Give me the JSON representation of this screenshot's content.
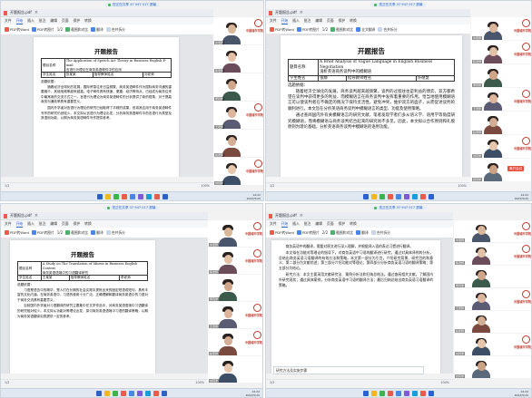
{
  "meeting_pill": "您正在共享 37 947 017 屏幕",
  "taskbar_time": "14:22",
  "taskbar_date": "2022/5/20",
  "leave_label": "离开会议",
  "panels": [
    {
      "file": "开题报告.pdf",
      "menus": [
        "文件",
        "开始",
        "插入",
        "批注",
        "编辑",
        "页面",
        "保护",
        "转换"
      ],
      "tools": [
        "PDF转Word",
        "PDF转图片",
        "截图和对比",
        "翻译",
        "合并拆分"
      ],
      "page_info": "1/2",
      "status": "1/2",
      "zoom": "100%",
      "doc_title": "开题报告",
      "table_rows": [
        [
          "题目名称",
          "The Application of Speech Act Theory in Business English E-mail\n言语行为理论在商务英语邮件中的应用"
        ],
        [
          "学生姓名",
          "张某某",
          "指导教师姓名",
          "刘老师"
        ]
      ],
      "section": "选题依据：",
      "paragraphs": [
        "随着经济全球化的发展，国际贸易往来日益频繁，商务英语邮件作为国际商务沟通的重要媒介，其使用频率越来越高。电子邮件具有快速、便捷、经济等特点，已经成为商务往来中最常用的交流方式之一。言语行为理论为商务英语邮件的分析提供了新的视角，对于提高商务沟通效率具有重要意义。",
        "国内外学者对言语行为理论的研究已经取得了丰硕的成果，但将其应用于商务英语邮件写作的研究仍然较少。本文拟从言语行为理论出发，分析商务英语邮件中的言语行为类型及其语用功能，以期为商务英语邮件写作提供参考。"
      ]
    },
    {
      "file": "开题报告.pdf",
      "menus": [
        "文件",
        "开始",
        "插入",
        "批注",
        "编辑",
        "页面",
        "保护",
        "转换"
      ],
      "tools": [
        "PDF转Word",
        "PDF转图片",
        "截图和对比",
        "全文翻译",
        "合并拆分"
      ],
      "page_info": "1/2",
      "status": "1/2",
      "zoom": "100%",
      "doc_title": "开题报告",
      "table_rows": [
        [
          "题目名称",
          "A Brief Analysis of Vague Language in English Business Negotiation\n浅析英语商务谈判中的模糊语"
        ],
        [
          "学生姓名",
          "张静",
          "指导教师姓名",
          "许德慧"
        ]
      ],
      "section": "选题依据：",
      "paragraphs": [
        "随着经济全球化的发展，商务谈判越来越频繁。谈判的过程往往是利益的博弈，双方都希望在谈判中获得更多的利益，而模糊语言在商务谈判中发挥着重要的作用。恰当地使用模糊语言可以使谈判者在不确定的情况下保持灵活性，避免冲突，维护双方的面子，从而促进谈判的顺利进行。本文旨在分析英语商务谈判中模糊语言的类型、功能及使用策略。",
        "通过查阅国内外有关模糊语言的研究文献，笔者发现学者们多从语义学、语用学等角度研究模糊语，而将模糊语与商务谈判结合起来的研究尚不多见。因此，本文拟以合作原则和礼貌原则为理论基础，分析英语商务谈判中模糊语的语用功能。"
      ]
    },
    {
      "file": "开题报告.pdf",
      "menus": [
        "文件",
        "开始",
        "插入",
        "批注",
        "编辑",
        "页面",
        "保护",
        "转换"
      ],
      "tools": [
        "PDF转Word",
        "PDF转图片",
        "截图和对比",
        "翻译",
        "合并拆分"
      ],
      "page_info": "1/2",
      "status": "1/2",
      "zoom": "100%",
      "doc_title": "开题报告",
      "table_rows": [
        [
          "题目名称",
          "A Study on The Translation of Idioms in Business English Context\n商务英语语境中的习语翻译研究"
        ],
        [
          "学生姓名",
          "王某某",
          "指导教师姓名",
          "李老师"
        ]
      ],
      "section": "选题依据：",
      "paragraphs": [
        "习语是语言中的精华，是人们在长期的社会实践中提炼出来的固定短语或短句，具有丰富的文化内涵。在商务英语中，习语的使用十分广泛，正确理解和翻译商务英语中的习语对于商务交流具有重要意义。",
        "目前国内外学者对习语翻译的研究主要集中在文学作品中，对商务英语语境中习语翻译的研究相对较少。本文拟从功能对等理论出发，探讨商务英语语境中习语的翻译策略，以期为商务英语翻译实践提供一定的参考。"
      ]
    },
    {
      "file": "开题报告.pdf",
      "menus": [
        "文件",
        "开始",
        "插入",
        "批注",
        "编辑",
        "页面",
        "保护",
        "转换"
      ],
      "tools": [
        "PDF转Word",
        "PDF转图片",
        "截图和对比",
        "翻译",
        "合并拆分"
      ],
      "page_info": "2/2",
      "status": "2/2",
      "zoom": "100%",
      "doc_title": "",
      "table_rows": [],
      "section": "",
      "paragraphs": [
        "商务英语中的翻译，需要对原文进行深入理解，并根据译入语的表达习惯进行翻译。",
        "本文拟在功能对等理论的指导下，对商务英语中习语的翻译进行研究，通过对具体译例的分析，总结出商务英语习语翻译的有效方法和策略。本文第一部分为引言，介绍研究背景、研究目的和意义；第二部分为文献综述；第三部分介绍功能对等理论；第四部分分析商务英语习语的翻译策略；第五部分为结论。",
        "研究方法：本文主要采用文献研究法、案例分析法和归纳总结法。通过查阅相关文献，了解国内外研究现状；通过具体案例，分析商务英语中习语的翻译方法；最后归纳总结出商务英语习语翻译的策略。"
      ],
      "chat_placeholder": "研究方法及实施步骤"
    }
  ],
  "video_columns": [
    {
      "tiles": [
        {
          "name": "许老师",
          "label": "中国城市学院"
        },
        {
          "name": "陈老师",
          "label": ""
        },
        {
          "name": "李同学",
          "label": ""
        },
        {
          "name": "王老师",
          "label": "中国城市学院"
        },
        {
          "name": "赵老师",
          "label": ""
        },
        {
          "name": "刘同学",
          "label": "中国城市学院"
        }
      ]
    },
    {
      "tiles": [
        {
          "name": "许老师",
          "label": "中国城市学院"
        },
        {
          "name": "陈老师",
          "label": "中国城市学院"
        },
        {
          "name": "李同学",
          "label": ""
        },
        {
          "name": "王老师",
          "label": "中国城市学院"
        },
        {
          "name": "赵老师",
          "label": ""
        },
        {
          "name": "刘同学",
          "label": "中国城市学院"
        },
        {
          "name": "张同学",
          "label": ""
        }
      ]
    },
    {
      "tiles": [
        {
          "name": "许老师",
          "label": "中国城市学院"
        },
        {
          "name": "陈老师",
          "label": "中国城市学院"
        },
        {
          "name": "李同学",
          "label": ""
        },
        {
          "name": "王老师",
          "label": "中国城市学院"
        },
        {
          "name": "赵老师",
          "label": "中国城市学院"
        },
        {
          "name": "刘同学",
          "label": ""
        }
      ]
    },
    {
      "tiles": [
        {
          "name": "许老师",
          "label": "中国城市学院"
        },
        {
          "name": "陈老师",
          "label": "中国城市学院"
        },
        {
          "name": "李同学",
          "label": ""
        },
        {
          "name": "王老师",
          "label": "中国城市学院"
        },
        {
          "name": "赵老师",
          "label": ""
        },
        {
          "name": "刘同学",
          "label": "中国城市学院"
        },
        {
          "name": "张同学",
          "label": ""
        }
      ]
    }
  ]
}
